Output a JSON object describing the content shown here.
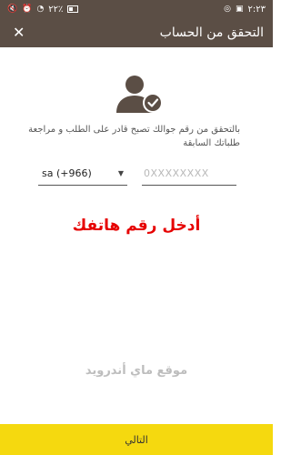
{
  "status_bar": {
    "time": "٢:٢٣",
    "battery": "٢٢٪"
  },
  "header": {
    "title": "التحقق من الحساب"
  },
  "description": "بالتحقق من رقم جوالك تصبح قادر على الطلب و مراجعة طلباتك السابقة",
  "phone_form": {
    "country_code": "sa (+966)",
    "phone_placeholder": "0XXXXXXXX"
  },
  "overlay_text": "أدخل رقم هاتفك",
  "watermark": "موقع ماي أندرويد",
  "next_button_label": "التالي",
  "colors": {
    "bar": "#5b4e45",
    "accent": "#f5d90f",
    "prompt": "#e60000"
  }
}
